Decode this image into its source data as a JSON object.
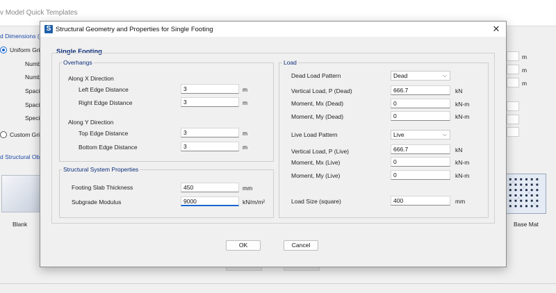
{
  "background": {
    "title": "v Model Quick Templates",
    "grid_dimensions_section": "d Dimensions (F",
    "uniform_grid_label": "Uniform Gric",
    "grid_rows": [
      "Numbe",
      "Numbe",
      "Spacin",
      "Spacin",
      "Specif"
    ],
    "custom_grid_label": "Custom Gric",
    "structural_objects_section": "d Structural Obj",
    "unit_labels": [
      "m",
      "m",
      "m"
    ],
    "blank_label": "Blank",
    "base_mat_label": "Base Mat"
  },
  "dialog": {
    "title": "Structural Geometry and Properties for Single Footing",
    "app_icon": "S",
    "close_glyph": "✕",
    "group_title": "Single Footing",
    "overhangs": {
      "title": "Overhangs",
      "along_x": "Along X Direction",
      "left_edge_label": "Left Edge Distance",
      "left_edge_value": "3",
      "left_edge_unit": "m",
      "right_edge_label": "Right Edge Distance",
      "right_edge_value": "3",
      "right_edge_unit": "m",
      "along_y": "Along Y Direction",
      "top_edge_label": "Top Edge Distance",
      "top_edge_value": "3",
      "top_edge_unit": "m",
      "bottom_edge_label": "Bottom Edge Distance",
      "bottom_edge_value": "3",
      "bottom_edge_unit": "m"
    },
    "structural_system": {
      "title": "Structural System Properties",
      "slab_thickness_label": "Footing Slab Thickness",
      "slab_thickness_value": "450",
      "slab_thickness_unit": "mm",
      "subgrade_label": "Subgrade Modulus",
      "subgrade_value": "9000",
      "subgrade_unit": "kN/m/m²"
    },
    "load": {
      "title": "Load",
      "dead_pattern_label": "Dead Load Pattern",
      "dead_pattern_value": "Dead",
      "vertical_dead_label": "Vertical Load, P (Dead)",
      "vertical_dead_value": "666.7",
      "vertical_dead_unit": "kN",
      "mx_dead_label": "Moment, Mx (Dead)",
      "mx_dead_value": "0",
      "mx_dead_unit": "kN-m",
      "my_dead_label": "Moment, My (Dead)",
      "my_dead_value": "0",
      "my_dead_unit": "kN-m",
      "live_pattern_label": "Live Load Pattern",
      "live_pattern_value": "Live",
      "vertical_live_label": "Vertical Load, P (Live)",
      "vertical_live_value": "666.7",
      "vertical_live_unit": "kN",
      "mx_live_label": "Moment, Mx (Live)",
      "mx_live_value": "0",
      "mx_live_unit": "kN-m",
      "my_live_label": "Moment, My (Live)",
      "my_live_value": "0",
      "my_live_unit": "kN-m",
      "load_size_label": "Load Size (square)",
      "load_size_value": "400",
      "load_size_unit": "mm"
    },
    "ok_label": "OK",
    "cancel_label": "Cancel",
    "dropdown_chevron": "⌵"
  },
  "colors": {
    "group_title": "#0c2d79",
    "focus_accent": "#1765cf",
    "app_icon": "#1f5fa8"
  }
}
